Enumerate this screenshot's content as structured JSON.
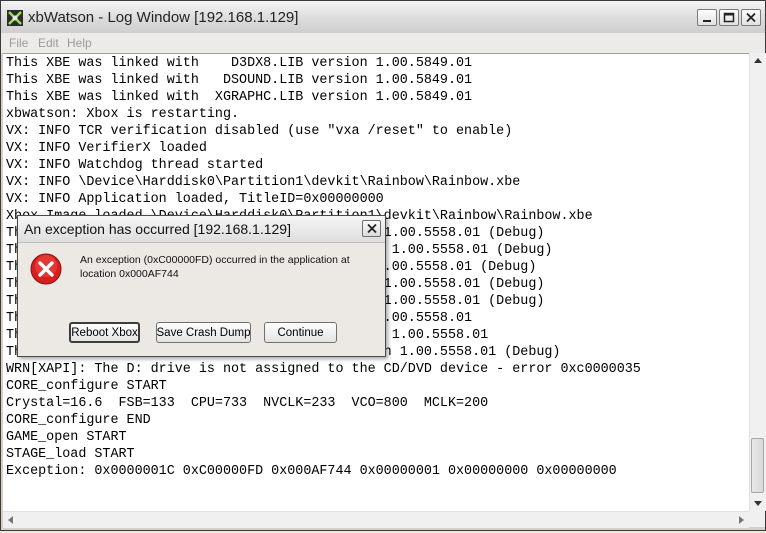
{
  "window": {
    "title": "xbWatson - Log Window [192.168.1.129]",
    "controls": {
      "minimize": "minimize-icon",
      "maximize": "maximize-icon",
      "close": "close-icon"
    }
  },
  "menu": {
    "items": [
      {
        "label": "File"
      },
      {
        "label": "Edit"
      },
      {
        "label": "Help"
      }
    ]
  },
  "log": {
    "lines": [
      "This XBE was linked with    D3DX8.LIB version 1.00.5849.01",
      "This XBE was linked with   DSOUND.LIB version 1.00.5849.01",
      "This XBE was linked with  XGRAPHC.LIB version 1.00.5849.01",
      "xbwatson: Xbox is restarting.",
      "VX: INFO TCR verification disabled (use \"vxa /reset\" to enable)",
      "VX: INFO VerifierX loaded",
      "VX: INFO Watchdog thread started",
      "VX: INFO \\Device\\Harddisk0\\Partition1\\devkit\\Rainbow\\Rainbow.xbe",
      "VX: INFO Application loaded, TitleID=0x00000000",
      "Xbox Image loaded \\Device\\Harddisk0\\Partition1\\devkit\\Rainbow\\Rainbow.xbe",
      "This XBE was linked with   XAPILIB.LIB version 1.00.5558.01 (Debug)",
      "This XBE was linked with   D3D8LTCG.LIB version 1.00.5558.01 (Debug)",
      "This XBE was linked with     D3D8.LIB version 1.00.5558.01 (Debug)",
      "This XBE was linked with   XGRAPHC.LIB version 1.00.5558.01 (Debug)",
      "This XBE was linked with    DSOUND.LIB version 1.00.5558.01 (Debug)",
      "This XBE was linked with   XNETSL.LIB version 1.00.5558.01",
      "This XBE was linked with    XONLINE.LIB version 1.00.5558.01",
      "This XBE was linked with    XBOXKRNL.LIB version 1.00.5558.01 (Debug)",
      "WRN[XAPI]: The D: drive is not assigned to the CD/DVD device - error 0xc0000035",
      "CORE_configure START",
      "Crystal=16.6  FSB=133  CPU=733  NVCLK=233  VCO=800  MCLK=200",
      "CORE_configure END",
      "GAME_open START",
      "STAGE_load START",
      "Exception: 0x0000001C 0xC00000FD 0x000AF744 0x00000001 0x00000000 0x00000000"
    ]
  },
  "dialog": {
    "title": "An exception has occurred [192.168.1.129]",
    "message": "An exception (0xC00000FD) occurred in the application at location 0x000AF744",
    "icon": "error-icon",
    "buttons": {
      "reboot": "Reboot Xbox",
      "save": "Save Crash Dump",
      "continue": "Continue"
    },
    "error_color": "#d81e1e"
  }
}
